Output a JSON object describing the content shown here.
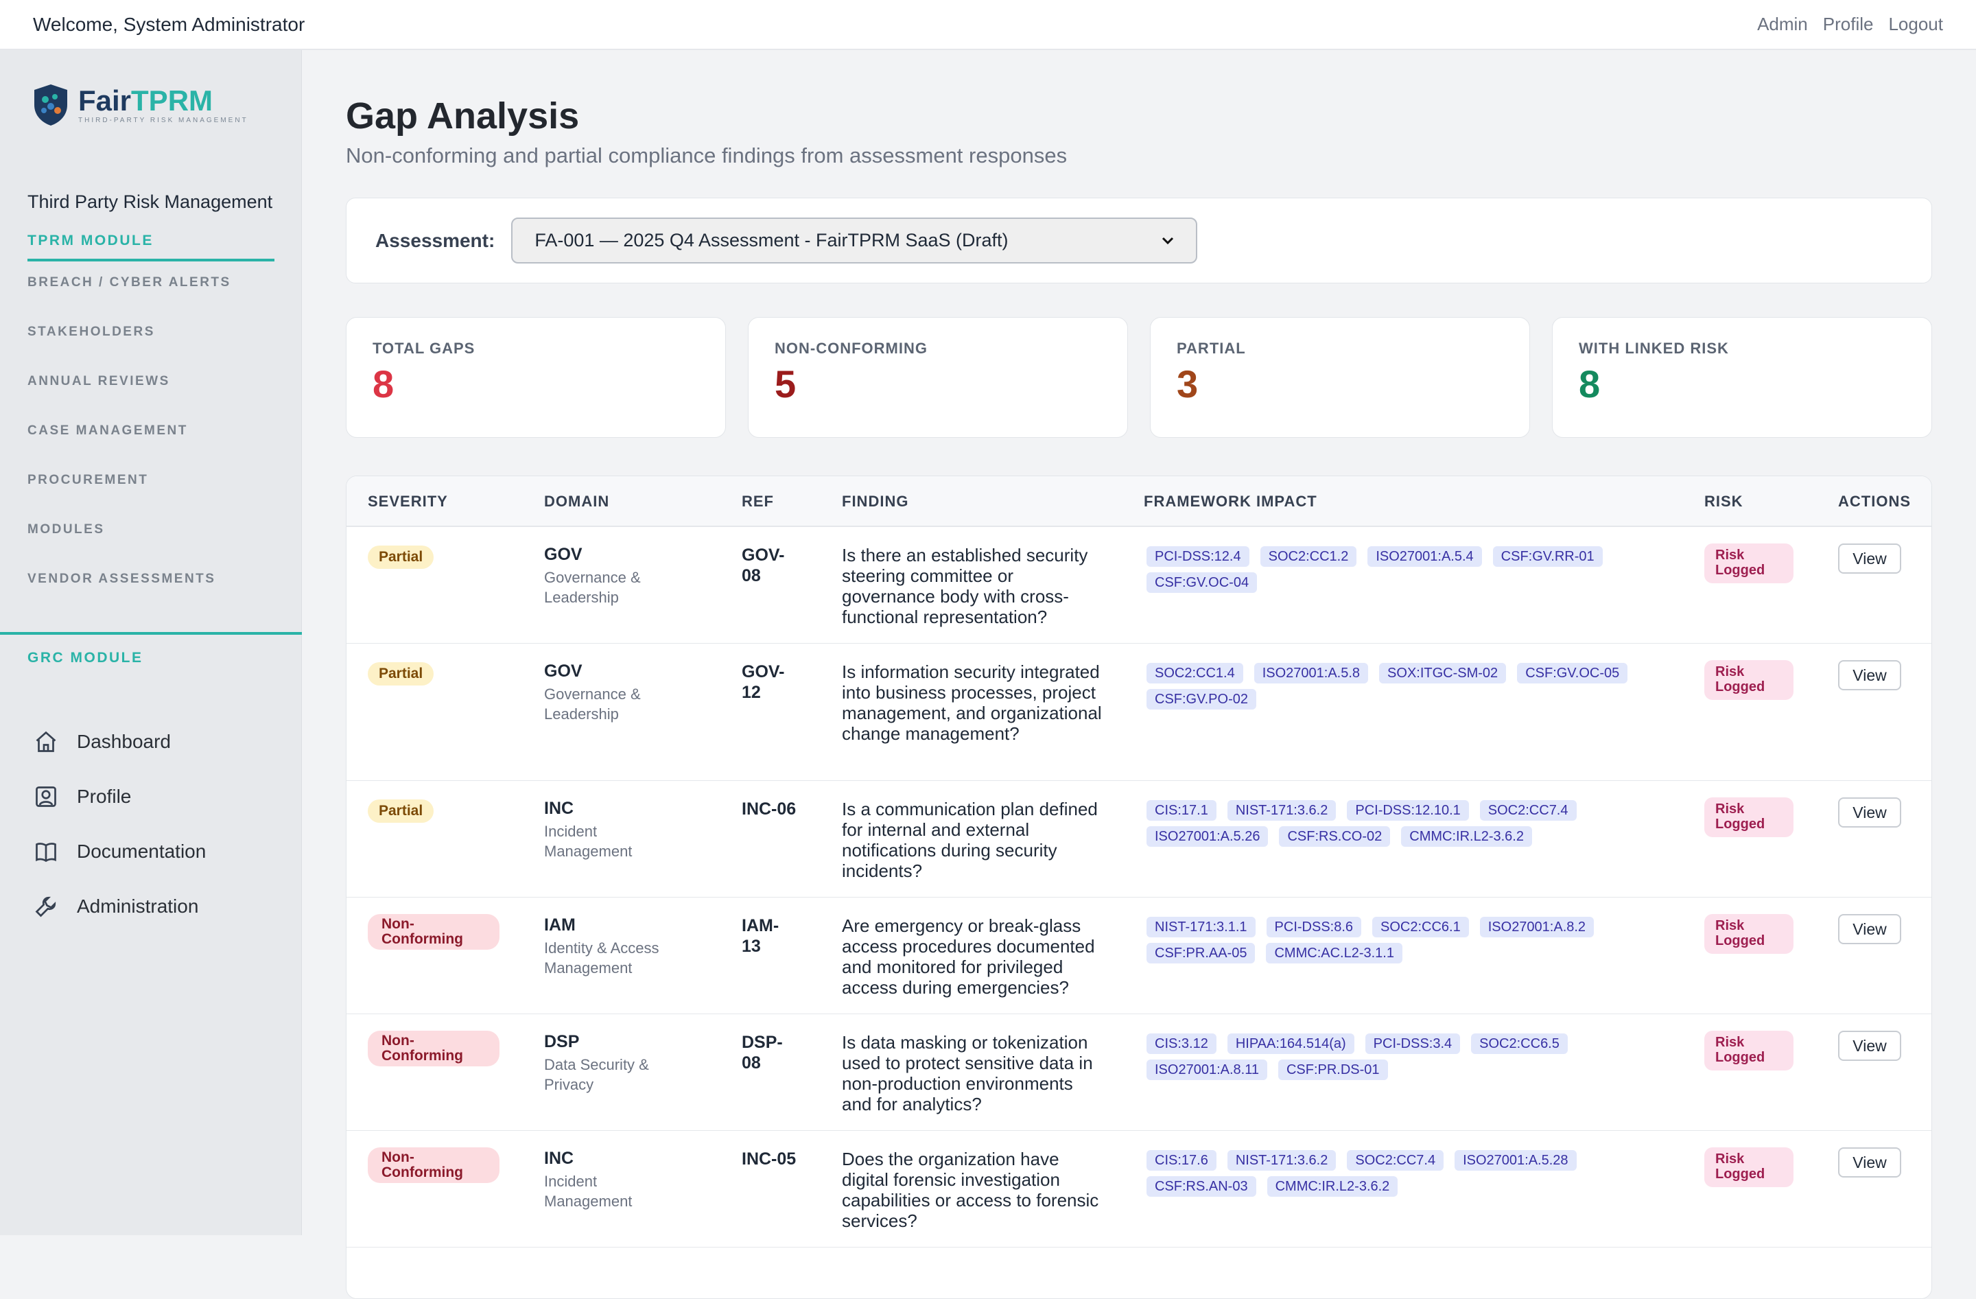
{
  "topbar": {
    "welcome": "Welcome, System Administrator",
    "links": [
      "Admin",
      "Profile",
      "Logout"
    ]
  },
  "sidebar": {
    "logo": {
      "fair": "Fair",
      "tprm": "TPRM",
      "tagline": "THIRD-PARTY RISK MANAGEMENT"
    },
    "brand_title": "Third Party Risk Management",
    "tprm_heading": "TPRM MODULE",
    "tprm_items": [
      "BREACH / CYBER ALERTS",
      "STAKEHOLDERS",
      "ANNUAL REVIEWS",
      "CASE MANAGEMENT",
      "PROCUREMENT",
      "MODULES",
      "VENDOR ASSESSMENTS"
    ],
    "grc_heading": "GRC MODULE",
    "grc_items": [
      {
        "label": "Dashboard",
        "icon": "home-icon"
      },
      {
        "label": "Profile",
        "icon": "user-icon"
      },
      {
        "label": "Documentation",
        "icon": "book-icon"
      },
      {
        "label": "Administration",
        "icon": "wrench-icon"
      }
    ]
  },
  "page": {
    "title": "Gap Analysis",
    "subtitle": "Non-conforming and partial compliance findings from assessment responses"
  },
  "assessment": {
    "label": "Assessment:",
    "selected": "FA-001 — 2025 Q4 Assessment - FairTPRM SaaS (Draft)"
  },
  "stats": [
    {
      "label": "TOTAL GAPS",
      "value": "8",
      "color": "#dc3545"
    },
    {
      "label": "NON-CONFORMING",
      "value": "5",
      "color": "#9b1c1c"
    },
    {
      "label": "PARTIAL",
      "value": "3",
      "color": "#a0461a"
    },
    {
      "label": "WITH LINKED RISK",
      "value": "8",
      "color": "#148a5e"
    }
  ],
  "table": {
    "headers": [
      "SEVERITY",
      "DOMAIN",
      "REF",
      "FINDING",
      "FRAMEWORK IMPACT",
      "RISK",
      "ACTIONS"
    ],
    "rows": [
      {
        "severity": "Partial",
        "domain_code": "GOV",
        "domain_name": "Governance & Leadership",
        "ref": "GOV-08",
        "finding": "Is there an established security steering committee or governance body with cross-functional representation?",
        "tags": [
          "PCI-DSS:12.4",
          "SOC2:CC1.2",
          "ISO27001:A.5.4",
          "CSF:GV.RR-01",
          "CSF:GV.OC-04"
        ],
        "risk": "Risk Logged",
        "action": "View"
      },
      {
        "severity": "Partial",
        "domain_code": "GOV",
        "domain_name": "Governance & Leadership",
        "ref": "GOV-12",
        "finding": "Is information security integrated into business processes, project management, and organizational change management?",
        "tags": [
          "SOC2:CC1.4",
          "ISO27001:A.5.8",
          "SOX:ITGC-SM-02",
          "CSF:GV.OC-05",
          "CSF:GV.PO-02"
        ],
        "risk": "Risk Logged",
        "action": "View"
      },
      {
        "severity": "Partial",
        "domain_code": "INC",
        "domain_name": "Incident Management",
        "ref": "INC-06",
        "finding": "Is a communication plan defined for internal and external notifications during security incidents?",
        "tags": [
          "CIS:17.1",
          "NIST-171:3.6.2",
          "PCI-DSS:12.10.1",
          "SOC2:CC7.4",
          "ISO27001:A.5.26",
          "CSF:RS.CO-02",
          "CMMC:IR.L2-3.6.2"
        ],
        "risk": "Risk Logged",
        "action": "View"
      },
      {
        "severity": "Non-Conforming",
        "domain_code": "IAM",
        "domain_name": "Identity & Access Management",
        "ref": "IAM-13",
        "finding": "Are emergency or break-glass access procedures documented and monitored for privileged access during emergencies?",
        "tags": [
          "NIST-171:3.1.1",
          "PCI-DSS:8.6",
          "SOC2:CC6.1",
          "ISO27001:A.8.2",
          "CSF:PR.AA-05",
          "CMMC:AC.L2-3.1.1"
        ],
        "risk": "Risk Logged",
        "action": "View"
      },
      {
        "severity": "Non-Conforming",
        "domain_code": "DSP",
        "domain_name": "Data Security & Privacy",
        "ref": "DSP-08",
        "finding": "Is data masking or tokenization used to protect sensitive data in non-production environments and for analytics?",
        "tags": [
          "CIS:3.12",
          "HIPAA:164.514(a)",
          "PCI-DSS:3.4",
          "SOC2:CC6.5",
          "ISO27001:A.8.11",
          "CSF:PR.DS-01"
        ],
        "risk": "Risk Logged",
        "action": "View"
      },
      {
        "severity": "Non-Conforming",
        "domain_code": "INC",
        "domain_name": "Incident Management",
        "ref": "INC-05",
        "finding": "Does the organization have digital forensic investigation capabilities or access to forensic services?",
        "tags": [
          "CIS:17.6",
          "NIST-171:3.6.2",
          "SOC2:CC7.4",
          "ISO27001:A.5.28",
          "CSF:RS.AN-03",
          "CMMC:IR.L2-3.6.2"
        ],
        "risk": "Risk Logged",
        "action": "View"
      }
    ]
  }
}
